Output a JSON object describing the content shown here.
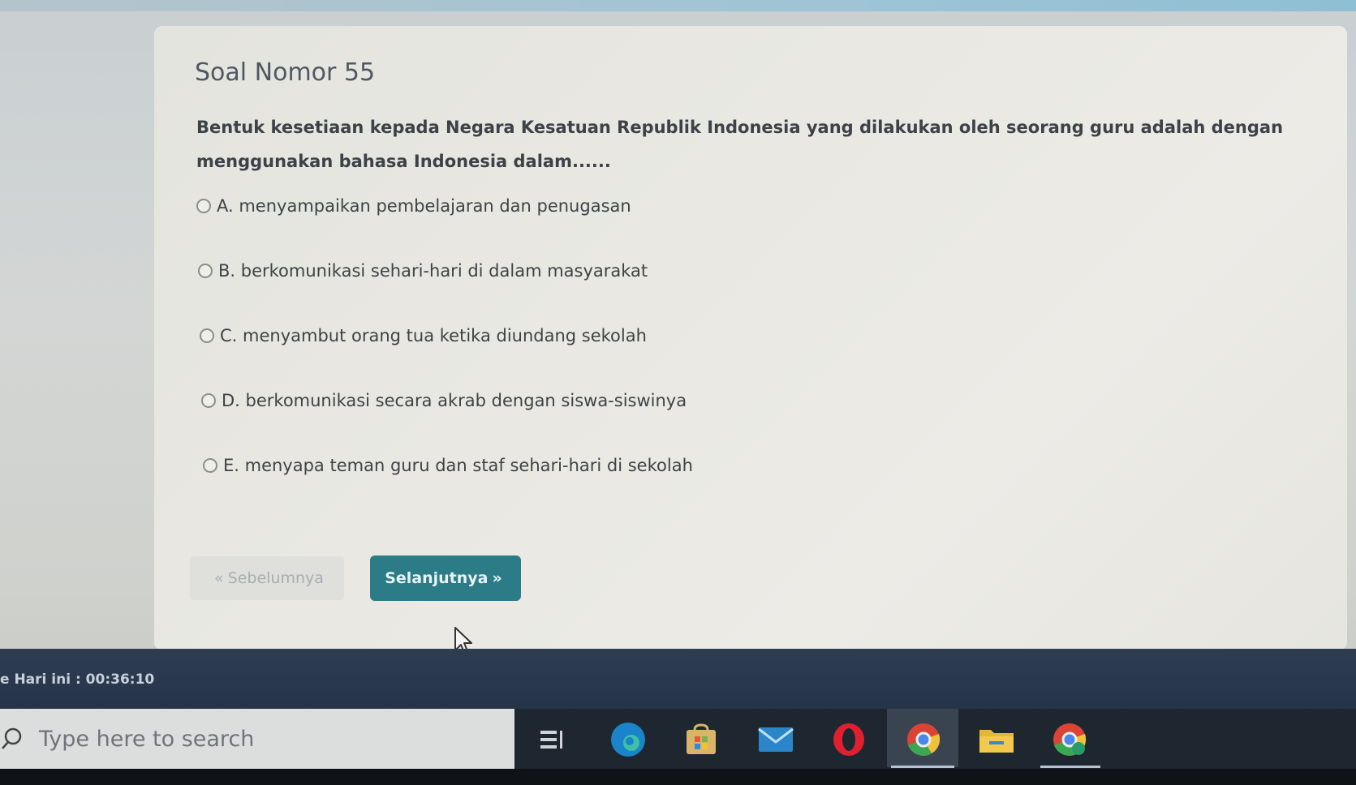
{
  "question": {
    "title": "Soal Nomor 55",
    "text": "Bentuk kesetiaan kepada Negara Kesatuan Republik Indonesia yang dilakukan oleh seorang guru adalah dengan menggunakan bahasa Indonesia dalam......",
    "options": [
      {
        "label": "A. menyampaikan pembelajaran dan penugasan"
      },
      {
        "label": "B. berkomunikasi sehari-hari di dalam masyarakat"
      },
      {
        "label": "C. menyambut orang tua ketika diundang sekolah"
      },
      {
        "label": "D. berkomunikasi secara akrab dengan siswa-siswinya"
      },
      {
        "label": "E. menyapa teman guru dan staf sehari-hari di sekolah"
      }
    ]
  },
  "nav": {
    "prev_label": "Sebelumnya",
    "next_label": "Selanjutnya",
    "prev_chevron": "«",
    "next_chevron": "»"
  },
  "timer": {
    "text": "e Hari ini : 00:36:10"
  },
  "taskbar": {
    "search_placeholder": "Type here to search",
    "icons": [
      "task-view-icon",
      "edge-icon",
      "store-icon",
      "mail-icon",
      "opera-icon",
      "chrome-icon",
      "file-explorer-icon",
      "chrome-profile-icon"
    ]
  },
  "colors": {
    "accent": "#2c7c88",
    "timer_bar": "#2f3d52",
    "taskbar": "#1e2630"
  }
}
